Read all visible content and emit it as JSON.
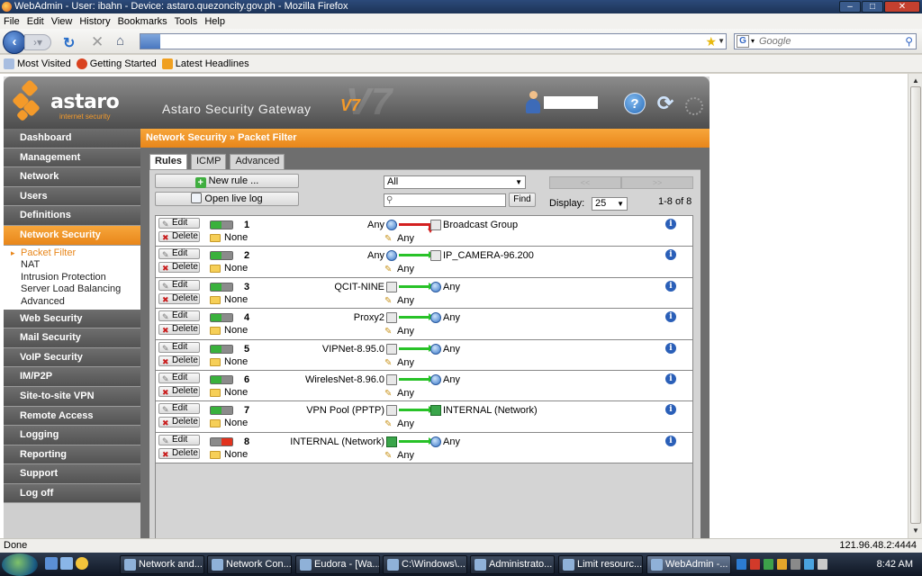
{
  "window": {
    "title": "WebAdmin - User: ibahn - Device: astaro.quezoncity.gov.ph - Mozilla Firefox"
  },
  "menu": [
    "File",
    "Edit",
    "View",
    "History",
    "Bookmarks",
    "Tools",
    "Help"
  ],
  "browser": {
    "url": "",
    "search_placeholder": "Google",
    "bookmarks": [
      "Most Visited",
      "Getting Started",
      "Latest Headlines"
    ],
    "status_left": "Done",
    "status_right": "121.96.48.2:4444"
  },
  "app": {
    "brand": "astaro",
    "brand_sub": "internet security",
    "product": "Astaro Security Gateway",
    "version": "V7",
    "version_short": "V7"
  },
  "nav": {
    "items": [
      {
        "label": "Dashboard"
      },
      {
        "label": "Management"
      },
      {
        "label": "Network"
      },
      {
        "label": "Users"
      },
      {
        "label": "Definitions"
      },
      {
        "label": "Network Security"
      },
      {
        "label": "Web Security"
      },
      {
        "label": "Mail Security"
      },
      {
        "label": "VoIP Security"
      },
      {
        "label": "IM/P2P"
      },
      {
        "label": "Site-to-site VPN"
      },
      {
        "label": "Remote Access"
      },
      {
        "label": "Logging"
      },
      {
        "label": "Reporting"
      },
      {
        "label": "Support"
      },
      {
        "label": "Log off"
      }
    ],
    "active_index": 5,
    "subitems": [
      "Packet Filter",
      "NAT",
      "Intrusion Protection",
      "Server Load Balancing",
      "Advanced"
    ]
  },
  "page": {
    "breadcrumb": "Network Security » Packet Filter",
    "tabs": [
      "Rules",
      "ICMP",
      "Advanced"
    ],
    "new_rule": "New rule ...",
    "live_log": "Open live log",
    "filter_value": "All",
    "find": "Find",
    "display_label": "Display:",
    "display_value": "25",
    "range": "1-8 of 8",
    "pager": [
      "<<",
      ">>"
    ]
  },
  "rules": [
    {
      "num": "1",
      "edit": "Edit",
      "delete": "Delete",
      "enabled": true,
      "group": "None",
      "source": "Any",
      "source_icon": "network-icon",
      "action": "deny",
      "dest": "Broadcast Group",
      "dest_icon": "host-icon",
      "service": "Any"
    },
    {
      "num": "2",
      "edit": "Edit",
      "delete": "Delete",
      "enabled": true,
      "group": "None",
      "source": "Any",
      "source_icon": "network-icon",
      "action": "allow",
      "dest": "IP_CAMERA-96.200",
      "dest_icon": "host-icon",
      "service": "Any"
    },
    {
      "num": "3",
      "edit": "Edit",
      "delete": "Delete",
      "enabled": true,
      "group": "None",
      "source": "QCIT-NINE",
      "source_icon": "host-icon",
      "action": "allow",
      "dest": "Any",
      "dest_icon": "network-icon",
      "service": "Any"
    },
    {
      "num": "4",
      "edit": "Edit",
      "delete": "Delete",
      "enabled": true,
      "group": "None",
      "source": "Proxy2",
      "source_icon": "host-icon",
      "action": "allow",
      "dest": "Any",
      "dest_icon": "network-icon",
      "service": "Any"
    },
    {
      "num": "5",
      "edit": "Edit",
      "delete": "Delete",
      "enabled": true,
      "group": "None",
      "source": "VIPNet-8.95.0",
      "source_icon": "host-icon",
      "action": "allow",
      "dest": "Any",
      "dest_icon": "network-icon",
      "service": "Any"
    },
    {
      "num": "6",
      "edit": "Edit",
      "delete": "Delete",
      "enabled": true,
      "group": "None",
      "source": "WirelesNet-8.96.0",
      "source_icon": "host-icon",
      "action": "allow",
      "dest": "Any",
      "dest_icon": "network-icon",
      "service": "Any"
    },
    {
      "num": "7",
      "edit": "Edit",
      "delete": "Delete",
      "enabled": true,
      "group": "None",
      "source": "VPN Pool (PPTP)",
      "source_icon": "host-icon",
      "action": "allow",
      "dest": "INTERNAL (Network)",
      "dest_icon": "lan-icon",
      "service": "Any"
    },
    {
      "num": "8",
      "edit": "Edit",
      "delete": "Delete",
      "enabled": false,
      "group": "None",
      "source": "INTERNAL (Network)",
      "source_icon": "lan-icon",
      "action": "allow",
      "dest": "Any",
      "dest_icon": "network-icon",
      "service": "Any"
    }
  ],
  "taskbar": {
    "tasks": [
      "Network and...",
      "Network Con...",
      "Eudora - [Wa...",
      "C:\\Windows\\...",
      "Administrato...",
      "Limit resourc...",
      "WebAdmin -..."
    ],
    "active_index": 6,
    "clock": "8:42 AM"
  },
  "colors": {
    "accent_orange": "#e8861a",
    "nav_gray": "#5f5f5f",
    "allow_green": "#28c228",
    "deny_red": "#d32020"
  }
}
